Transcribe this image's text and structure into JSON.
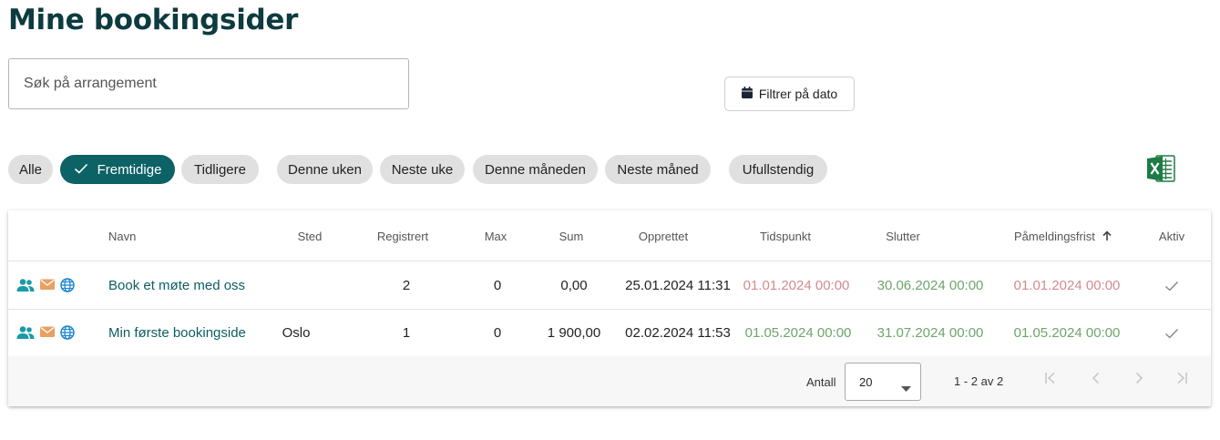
{
  "page": {
    "title": "Mine bookingsider"
  },
  "search": {
    "placeholder": "Søk på arrangement"
  },
  "date_filter": {
    "label": "Filtrer på dato",
    "icon": "calendar-icon"
  },
  "chips": [
    {
      "label": "Alle",
      "active": false
    },
    {
      "label": "Fremtidige",
      "active": true
    },
    {
      "label": "Tidligere",
      "active": false
    },
    {
      "label": "Denne uken",
      "active": false
    },
    {
      "label": "Neste uke",
      "active": false
    },
    {
      "label": "Denne måneden",
      "active": false
    },
    {
      "label": "Neste måned",
      "active": false
    },
    {
      "label": "Ufullstendig",
      "active": false
    }
  ],
  "export": {
    "icon": "excel-icon"
  },
  "table": {
    "columns": [
      "Navn",
      "Sted",
      "Registrert",
      "Max",
      "Sum",
      "Opprettet",
      "Tidspunkt",
      "Slutter",
      "Påmeldingsfrist",
      "Aktiv"
    ],
    "sorted_column": "Påmeldingsfrist",
    "rows": [
      {
        "name": "Book et møte med oss",
        "place": "",
        "registered": "2",
        "max": "0",
        "sum": "0,00",
        "created": "25.01.2024 11:31",
        "time": "01.01.2024 00:00",
        "ends": "30.06.2024 00:00",
        "deadline": "01.01.2024 00:00",
        "time_status": "past",
        "ends_status": "future",
        "deadline_status": "past"
      },
      {
        "name": "Min første bookingside",
        "place": "Oslo",
        "registered": "1",
        "max": "0",
        "sum": "1 900,00",
        "created": "02.02.2024 11:53",
        "time": "01.05.2024 00:00",
        "ends": "31.07.2024 00:00",
        "deadline": "01.05.2024 00:00",
        "time_status": "future",
        "ends_status": "future",
        "deadline_status": "future"
      }
    ]
  },
  "pagination": {
    "count_label": "Antall",
    "page_size": "20",
    "range_text": "1 - 2 av 2"
  },
  "colors": {
    "brand": "#0d6266",
    "title": "#0d3b3f",
    "past_date": "#d48b8e",
    "future_date": "#6da56b",
    "people_icon": "#1a9aa8",
    "mail_icon": "#e8a063",
    "globe_icon": "#1f86d1",
    "excel": "#1e7b45"
  }
}
